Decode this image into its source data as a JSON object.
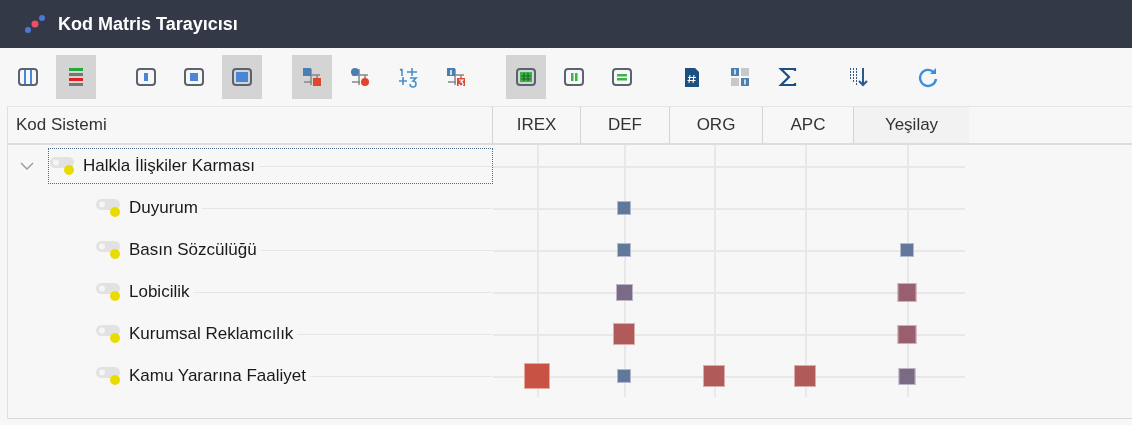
{
  "window": {
    "title": "Kod Matris Tarayıcısı"
  },
  "toolbar": [
    [
      {
        "kind": "columns",
        "selected": false
      },
      {
        "kind": "rows",
        "selected": true
      }
    ],
    [
      {
        "kind": "small-cell",
        "selected": false
      },
      {
        "kind": "medium-cell",
        "selected": false
      },
      {
        "kind": "large-cell",
        "selected": true
      }
    ],
    [
      {
        "kind": "squares",
        "selected": true
      },
      {
        "kind": "circles",
        "selected": false
      },
      {
        "kind": "numbers",
        "selected": false
      },
      {
        "kind": "number-squares",
        "selected": false
      }
    ],
    [
      {
        "kind": "grid-hash",
        "selected": true
      },
      {
        "kind": "grid-pause",
        "selected": false
      },
      {
        "kind": "grid-equal",
        "selected": false
      }
    ],
    [
      {
        "kind": "hash-doc",
        "selected": false
      },
      {
        "kind": "diagonal",
        "selected": false
      },
      {
        "kind": "sum",
        "selected": false
      }
    ],
    [
      {
        "kind": "sort",
        "selected": false
      }
    ],
    [
      {
        "kind": "refresh",
        "selected": false
      }
    ]
  ],
  "table": {
    "columns": [
      "Kod Sistemi",
      "IREX",
      "DEF",
      "ORG",
      "APC",
      "Yeşilay"
    ],
    "rows": [
      {
        "label": "Halkla İlişkiler Karması",
        "expanded": true,
        "selected": true,
        "cells": [
          null,
          null,
          null,
          null,
          null
        ],
        "children": [
          {
            "label": "Duyurum",
            "selected": false,
            "cells": [
              null,
              {
                "kind": "tiny"
              },
              null,
              null,
              null
            ]
          },
          {
            "label": "Basın Sözcülüğü",
            "selected": false,
            "cells": [
              null,
              {
                "kind": "tiny"
              },
              null,
              null,
              {
                "kind": "tiny"
              }
            ]
          },
          {
            "label": "Lobicilik",
            "selected": false,
            "cells": [
              null,
              {
                "kind": "small"
              },
              null,
              null,
              {
                "kind": "medium"
              }
            ]
          },
          {
            "label": "Kurumsal Reklamcılık",
            "selected": false,
            "cells": [
              null,
              {
                "kind": "large"
              },
              null,
              null,
              {
                "kind": "medium"
              }
            ]
          },
          {
            "label": "Kamu Yararına Faaliyet",
            "selected": false,
            "cells": [
              {
                "kind": "huge"
              },
              {
                "kind": "tiny"
              },
              {
                "kind": "large"
              },
              {
                "kind": "large"
              },
              {
                "kind": "small"
              }
            ]
          }
        ]
      }
    ]
  }
}
